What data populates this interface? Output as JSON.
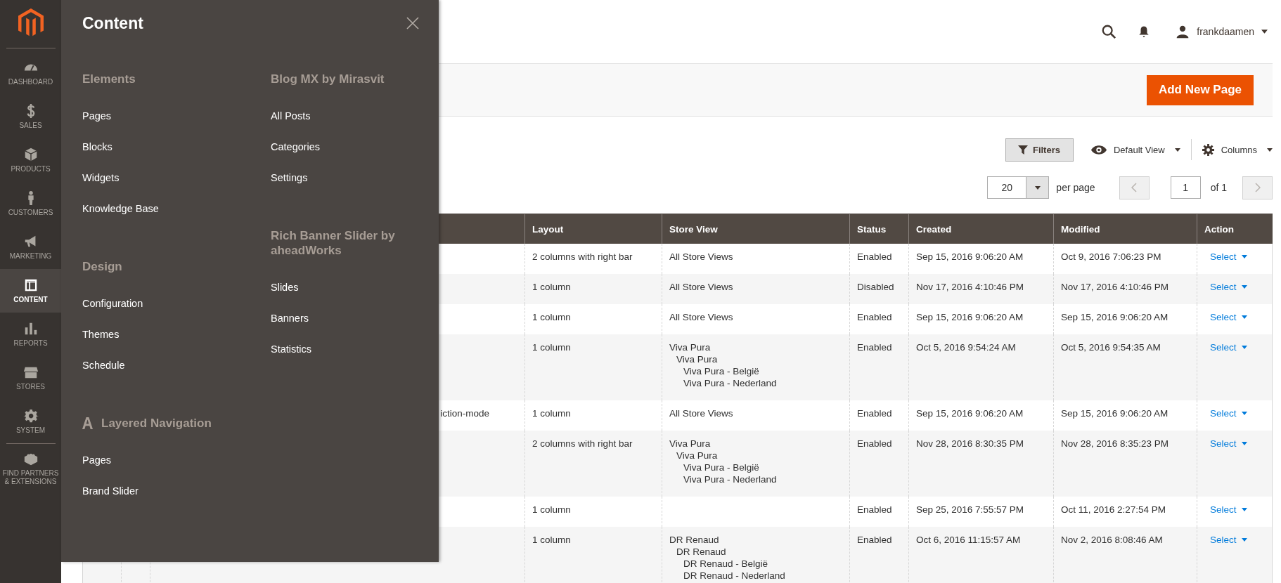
{
  "sidebar": {
    "items": [
      {
        "label": "DASHBOARD",
        "selected": false
      },
      {
        "label": "SALES",
        "selected": false
      },
      {
        "label": "PRODUCTS",
        "selected": false
      },
      {
        "label": "CUSTOMERS",
        "selected": false
      },
      {
        "label": "MARKETING",
        "selected": false
      },
      {
        "label": "CONTENT",
        "selected": true
      },
      {
        "label": "REPORTS",
        "selected": false
      },
      {
        "label": "STORES",
        "selected": false
      },
      {
        "label": "SYSTEM",
        "selected": false
      },
      {
        "label": "FIND PARTNERS & EXTENSIONS",
        "selected": false
      }
    ]
  },
  "header": {
    "user": "frankdaamen"
  },
  "page_actions": {
    "primary_button": "Add New Page"
  },
  "toolbar": {
    "filters": "Filters",
    "view": "Default View",
    "columns": "Columns",
    "per_page_value": "20",
    "per_page_label": "per page",
    "page": "1",
    "page_total": "of 1"
  },
  "table": {
    "columns": [
      "Layout",
      "Store View",
      "Status",
      "Created",
      "Modified",
      "Action"
    ],
    "rows": [
      {
        "layout": "2 columns with right bar",
        "store_view": [
          {
            "label": "All Store Views"
          }
        ],
        "status": "Enabled",
        "created": "Sep 15, 2016 9:06:20 AM",
        "modified": "Oct 9, 2016 7:06:23 PM",
        "action": "Select"
      },
      {
        "layout": "1 column",
        "store_view": [
          {
            "label": "All Store Views"
          }
        ],
        "status": "Disabled",
        "created": "Nov 17, 2016 4:10:46 PM",
        "modified": "Nov 17, 2016 4:10:46 PM",
        "action": "Select"
      },
      {
        "layout": "1 column",
        "store_view": [
          {
            "label": "All Store Views"
          }
        ],
        "status": "Enabled",
        "created": "Sep 15, 2016 9:06:20 AM",
        "modified": "Sep 15, 2016 9:06:20 AM",
        "action": "Select"
      },
      {
        "layout": "1 column",
        "store_view": [
          {
            "label": "Viva Pura",
            "children": [
              {
                "label": "Viva Pura",
                "children": [
                  {
                    "label": "Viva Pura - België"
                  },
                  {
                    "label": "Viva Pura - Nederland"
                  }
                ]
              }
            ]
          }
        ],
        "status": "Enabled",
        "created": "Oct 5, 2016 9:54:24 AM",
        "modified": "Oct 5, 2016 9:54:35 AM",
        "action": "Select"
      },
      {
        "title": "iction-mode",
        "layout": "1 column",
        "store_view": [
          {
            "label": "All Store Views"
          }
        ],
        "status": "Enabled",
        "created": "Sep 15, 2016 9:06:20 AM",
        "modified": "Sep 15, 2016 9:06:20 AM",
        "action": "Select"
      },
      {
        "layout": "2 columns with right bar",
        "store_view": [
          {
            "label": "Viva Pura",
            "children": [
              {
                "label": "Viva Pura",
                "children": [
                  {
                    "label": "Viva Pura - België"
                  },
                  {
                    "label": "Viva Pura - Nederland"
                  }
                ]
              }
            ]
          }
        ],
        "status": "Enabled",
        "created": "Nov 28, 2016 8:30:35 PM",
        "modified": "Nov 28, 2016 8:35:23 PM",
        "action": "Select"
      },
      {
        "layout": "1 column",
        "status": "Enabled",
        "created": "Sep 25, 2016 7:55:57 PM",
        "modified": "Oct 11, 2016 2:27:54 PM",
        "action": "Select"
      },
      {
        "layout": "1 column",
        "store_view": [
          {
            "label": "DR Renaud",
            "children": [
              {
                "label": "DR Renaud",
                "children": [
                  {
                    "label": "DR Renaud - België"
                  },
                  {
                    "label": "DR Renaud - Nederland"
                  }
                ]
              }
            ]
          }
        ],
        "status": "Enabled",
        "created": "Oct 6, 2016 11:15:57 AM",
        "modified": "Nov 2, 2016 8:08:46 AM",
        "action": "Select"
      }
    ]
  },
  "flyout": {
    "title": "Content",
    "columns": [
      [
        {
          "kind": "plain",
          "heading": "Elements",
          "items": [
            "Pages",
            "Blocks",
            "Widgets",
            "Knowledge Base"
          ]
        },
        {
          "kind": "plain",
          "heading": "Design",
          "items": [
            "Configuration",
            "Themes",
            "Schedule"
          ]
        },
        {
          "kind": "logo",
          "heading": "Layered Navigation",
          "items": [
            "Pages",
            "Brand Slider"
          ]
        }
      ],
      [
        {
          "kind": "plain",
          "heading": "Blog MX by Mirasvit",
          "items": [
            "All Posts",
            "Categories",
            "Settings"
          ]
        },
        {
          "kind": "plain",
          "heading": "Rich Banner Slider by aheadWorks",
          "items": [
            "Slides",
            "Banners",
            "Statistics"
          ]
        }
      ]
    ]
  }
}
